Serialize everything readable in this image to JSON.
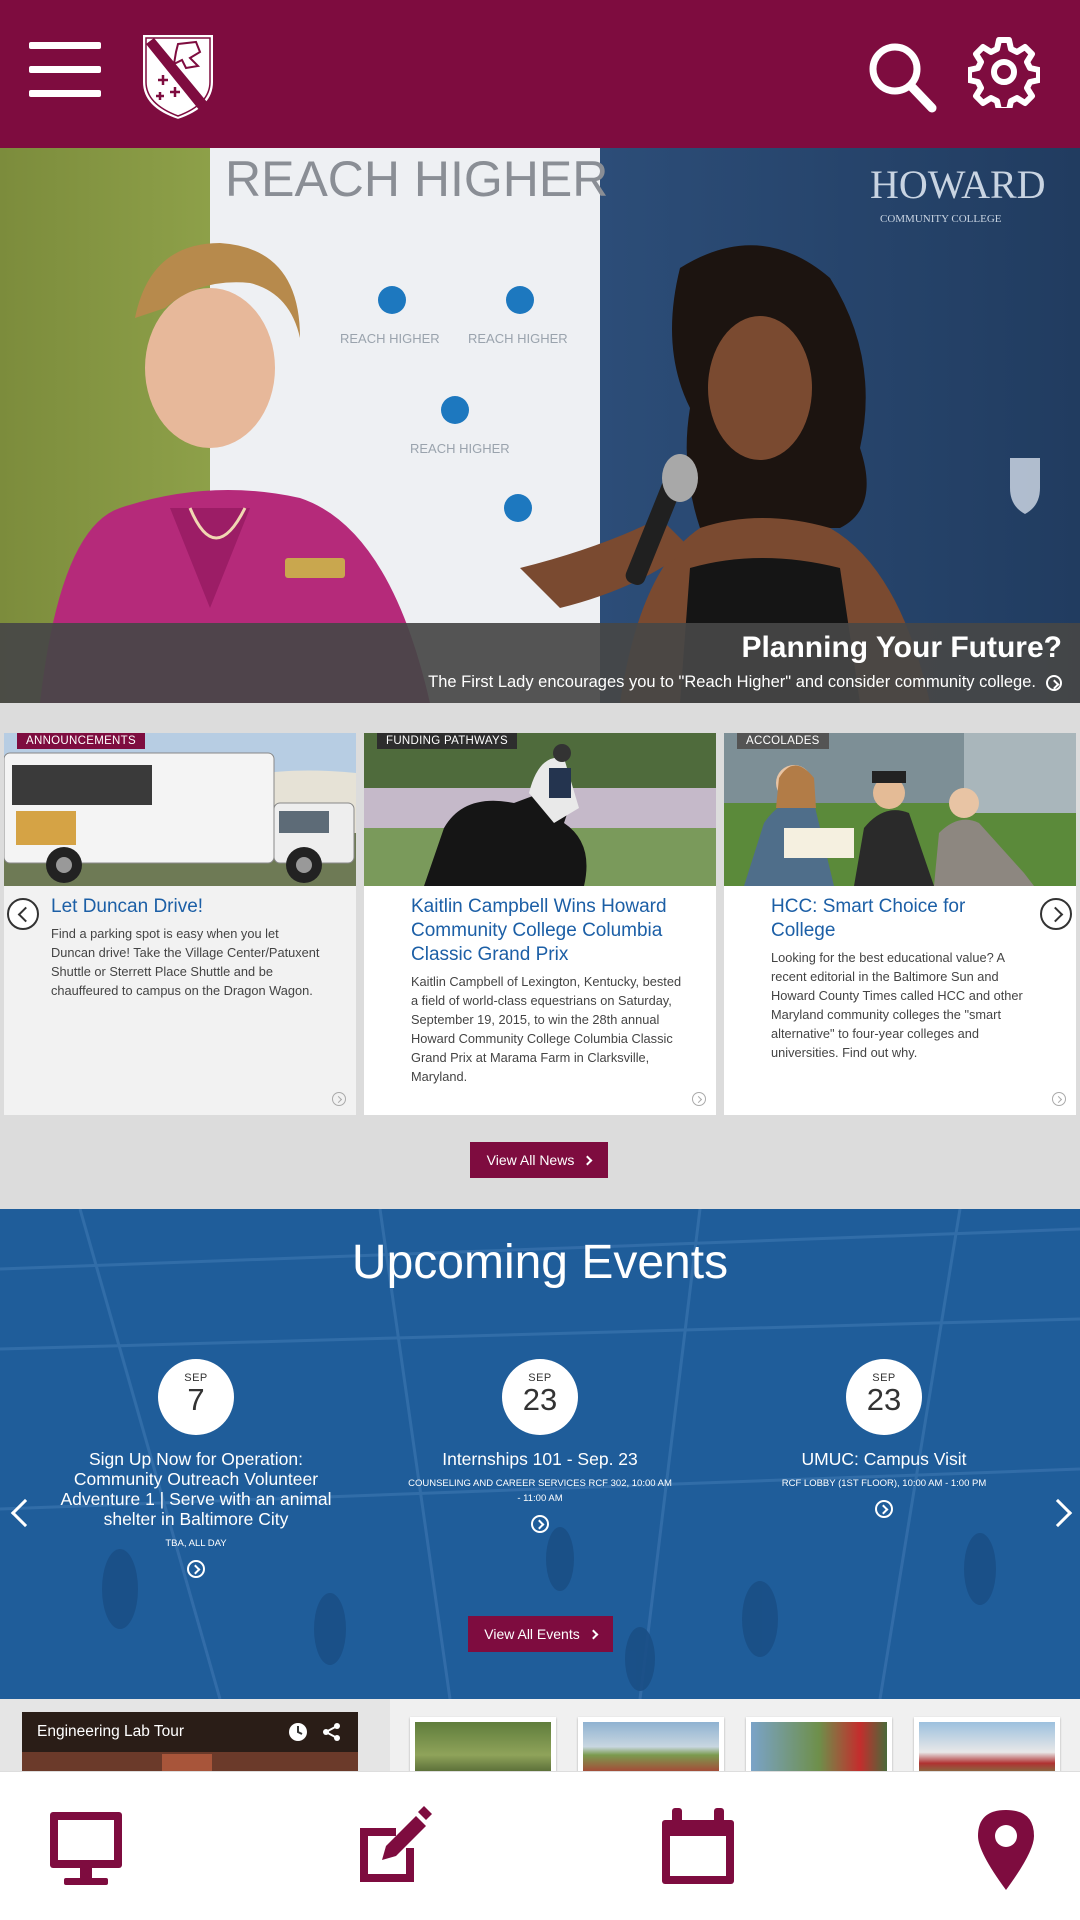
{
  "header": {
    "menu_icon": "hamburger-menu-icon",
    "logo_icon": "college-crest-icon",
    "search_icon": "search-icon",
    "settings_icon": "gear-icon",
    "brand_color": "#7e0c3f"
  },
  "hero": {
    "banner_text": "REACH HIGHER",
    "side_logo_text": "HOWARD",
    "side_logo_sub": "COMMUNITY COLLEGE",
    "sign_logo_text": "REACH HIGHER",
    "title": "Planning Your Future?",
    "subtitle": "The First Lady encourages you to \"Reach Higher\" and consider community college."
  },
  "news": {
    "cards": [
      {
        "tag": "ANNOUNCEMENTS",
        "title": "Let Duncan Drive!",
        "body": "Find a parking spot is easy when you let Duncan drive! Take the Village Center/Patuxent Shuttle or Sterrett Place Shuttle and be chauffeured to campus on the Dragon Wagon."
      },
      {
        "tag": "FUNDING PATHWAYS",
        "title": "Kaitlin Campbell Wins Howard Community College Columbia Classic Grand Prix",
        "body": "Kaitlin Campbell of Lexington, Kentucky, bested a field of world-class equestrians on Saturday, September 19, 2015, to win the 28th annual Howard Community College Columbia Classic Grand Prix at Marama Farm in Clarksville, Maryland."
      },
      {
        "tag": "ACCOLADES",
        "title": "HCC: Smart Choice for College",
        "body": "Looking for the best educational value? A recent editorial in the Baltimore Sun and Howard County Times called HCC and other Maryland community colleges the \"smart alternative\" to four-year colleges and universities. Find out why."
      }
    ],
    "view_all_label": "View All News"
  },
  "events": {
    "heading": "Upcoming Events",
    "items": [
      {
        "month": "SEP",
        "day": "7",
        "title": "Sign Up Now for Operation: Community Outreach Volunteer Adventure 1 | Serve with an animal shelter in Baltimore City",
        "location": "TBA, ALL DAY"
      },
      {
        "month": "SEP",
        "day": "23",
        "title": "Internships 101 - Sep. 23",
        "location": "COUNSELING AND CAREER SERVICES RCF 302, 10:00 AM - 11:00 AM"
      },
      {
        "month": "SEP",
        "day": "23",
        "title": "UMUC: Campus Visit",
        "location": "RCF LOBBY (1ST FLOOR), 10:00 AM - 1:00 PM"
      }
    ],
    "view_all_label": "View All Events"
  },
  "media": {
    "video_title": "Engineering Lab Tour",
    "video_icons": [
      "clock-icon",
      "share-icon"
    ]
  },
  "tabbar": {
    "items": [
      "desktop-icon",
      "edit-icon",
      "calendar-icon",
      "location-pin-icon"
    ]
  }
}
